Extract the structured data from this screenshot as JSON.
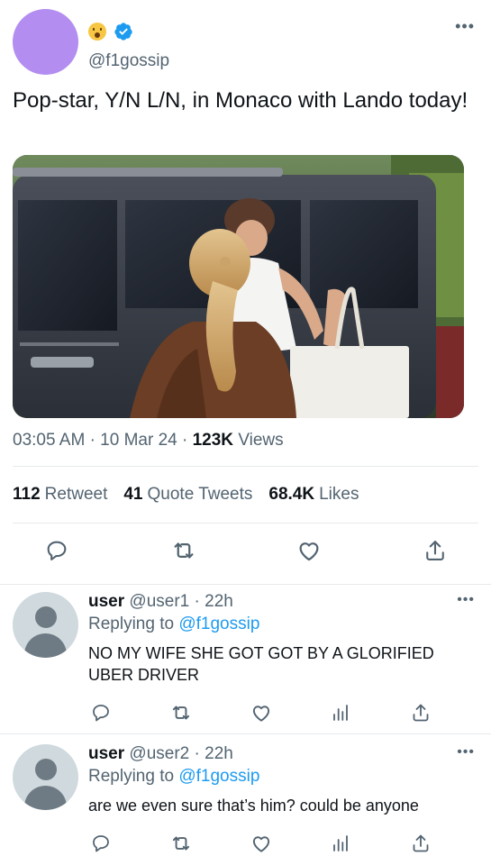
{
  "tweet": {
    "handle": "@f1gossip",
    "text": "Pop-star, Y/N L/N, in Monaco with Lando today!",
    "time": "03:05 AM",
    "date": "10 Mar 24",
    "views_count": "123K",
    "views_label": "Views",
    "sep": "·",
    "more": "•••",
    "photo_icon": "photo-image",
    "avatar_color": "#b38df0",
    "emoji_icon": "hushed-face-emoji",
    "verified_icon": "verified-badge",
    "verified_color": "#1d9bf0"
  },
  "stats": {
    "retweets_count": "112",
    "retweets_label": "Retweet",
    "quotes_count": "41",
    "quotes_label": "Quote Tweets",
    "likes_count": "68.4K",
    "likes_label": "Likes"
  },
  "actions": [
    "reply-icon",
    "retweet-icon",
    "like-icon",
    "share-icon"
  ],
  "replies": [
    {
      "name": "user",
      "handle": "@user1",
      "time": "22h",
      "replying_prefix": "Replying to",
      "replying_to": "@f1gossip",
      "text": "NO MY WIFE SHE GOT GOT BY A GLORIFIED UBER DRIVER"
    },
    {
      "name": "user",
      "handle": "@user2",
      "time": "22h",
      "replying_prefix": "Replying to",
      "replying_to": "@f1gossip",
      "text": "are we even sure that’s him? could be anyone"
    }
  ],
  "reply_actions": [
    "reply-icon",
    "retweet-icon",
    "like-icon",
    "analytics-icon",
    "share-icon"
  ],
  "colors": {
    "text": "#0f1419",
    "secondary": "#536471",
    "link": "#1d9bf0",
    "divider": "#e6e9eb"
  }
}
